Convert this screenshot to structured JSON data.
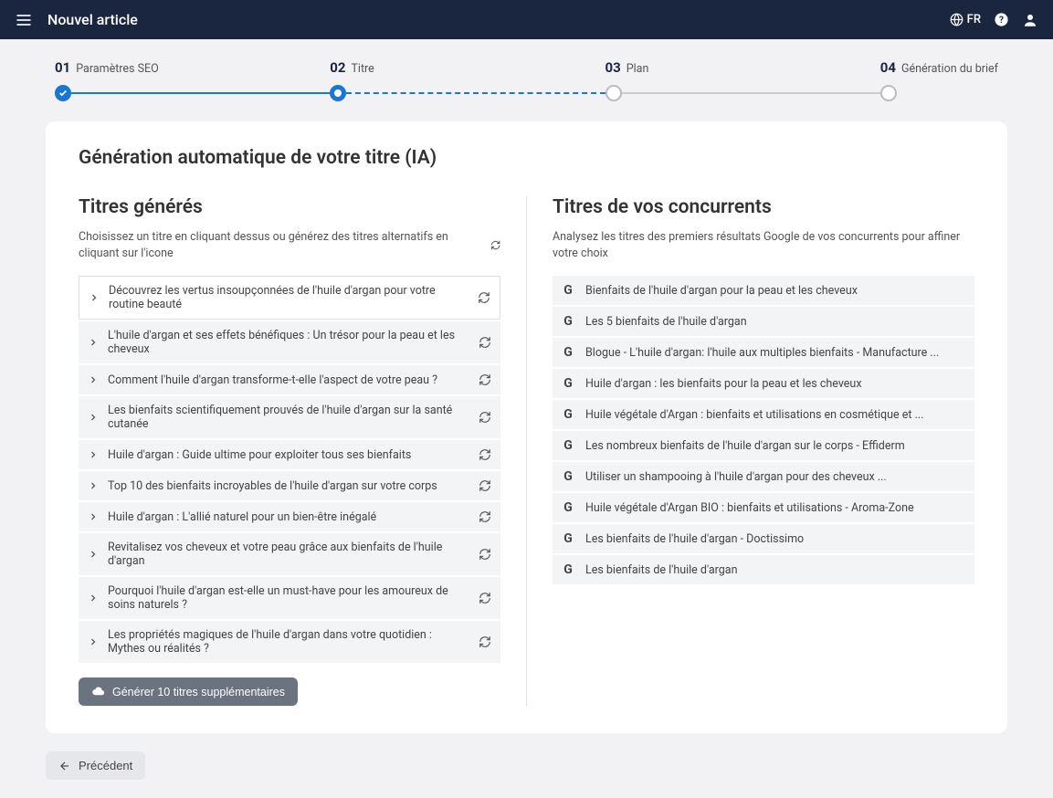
{
  "header": {
    "title": "Nouvel article",
    "lang": "FR"
  },
  "steps": [
    {
      "num": "01",
      "label": "Paramètres SEO"
    },
    {
      "num": "02",
      "label": "Titre"
    },
    {
      "num": "03",
      "label": "Plan"
    },
    {
      "num": "04",
      "label": "Génération du brief"
    }
  ],
  "main_title": "Génération automatique de votre titre (IA)",
  "generated": {
    "heading": "Titres générés",
    "subtitle": "Choisissez un titre en cliquant dessus ou générez des titres alternatifs en cliquant sur l'icone",
    "items": [
      "Découvrez les vertus insoupçonnées de l'huile d'argan pour votre routine beauté",
      "L'huile d'argan et ses effets bénéfiques : Un trésor pour la peau et les cheveux",
      "Comment l'huile d'argan transforme-t-elle l'aspect de votre peau ?",
      "Les bienfaits scientifiquement prouvés de l'huile d'argan sur la santé cutanée",
      "Huile d'argan : Guide ultime pour exploiter tous ses bienfaits",
      "Top 10 des bienfaits incroyables de l'huile d'argan sur votre corps",
      "Huile d'argan : L'allié naturel pour un bien-être inégalé",
      "Revitalisez vos cheveux et votre peau grâce aux bienfaits de l'huile d'argan",
      "Pourquoi l'huile d'argan est-elle un must-have pour les amoureux de soins naturels ?",
      "Les propriétés magiques de l'huile d'argan dans votre quotidien : Mythes ou réalités ?"
    ],
    "gen_more_label": "Générer 10 titres supplémentaires"
  },
  "competitors": {
    "heading": "Titres de vos concurrents",
    "subtitle": "Analysez les titres des premiers résultats Google de vos concurrents pour affiner votre choix",
    "items": [
      "Bienfaits de l'huile d'argan pour la peau et les cheveux",
      "Les 5 bienfaits de l'huile d'argan",
      "Blogue - L'huile d'argan: l'huile aux multiples bienfaits - Manufacture ...",
      "Huile d'argan : les bienfaits pour la peau et les cheveux",
      "Huile végétale d'Argan : bienfaits et utilisations en cosmétique et ...",
      "Les nombreux bienfaits de l'huile d'argan sur le corps - Effiderm",
      "Utiliser un shampooing à l'huile d'argan pour des cheveux ...",
      "Huile végétale d'Argan BIO : bienfaits et utilisations - Aroma-Zone",
      "Les bienfaits de l'huile d'argan - Doctissimo",
      "Les bienfaits de l'huile d'argan"
    ]
  },
  "back_label": "Précédent"
}
